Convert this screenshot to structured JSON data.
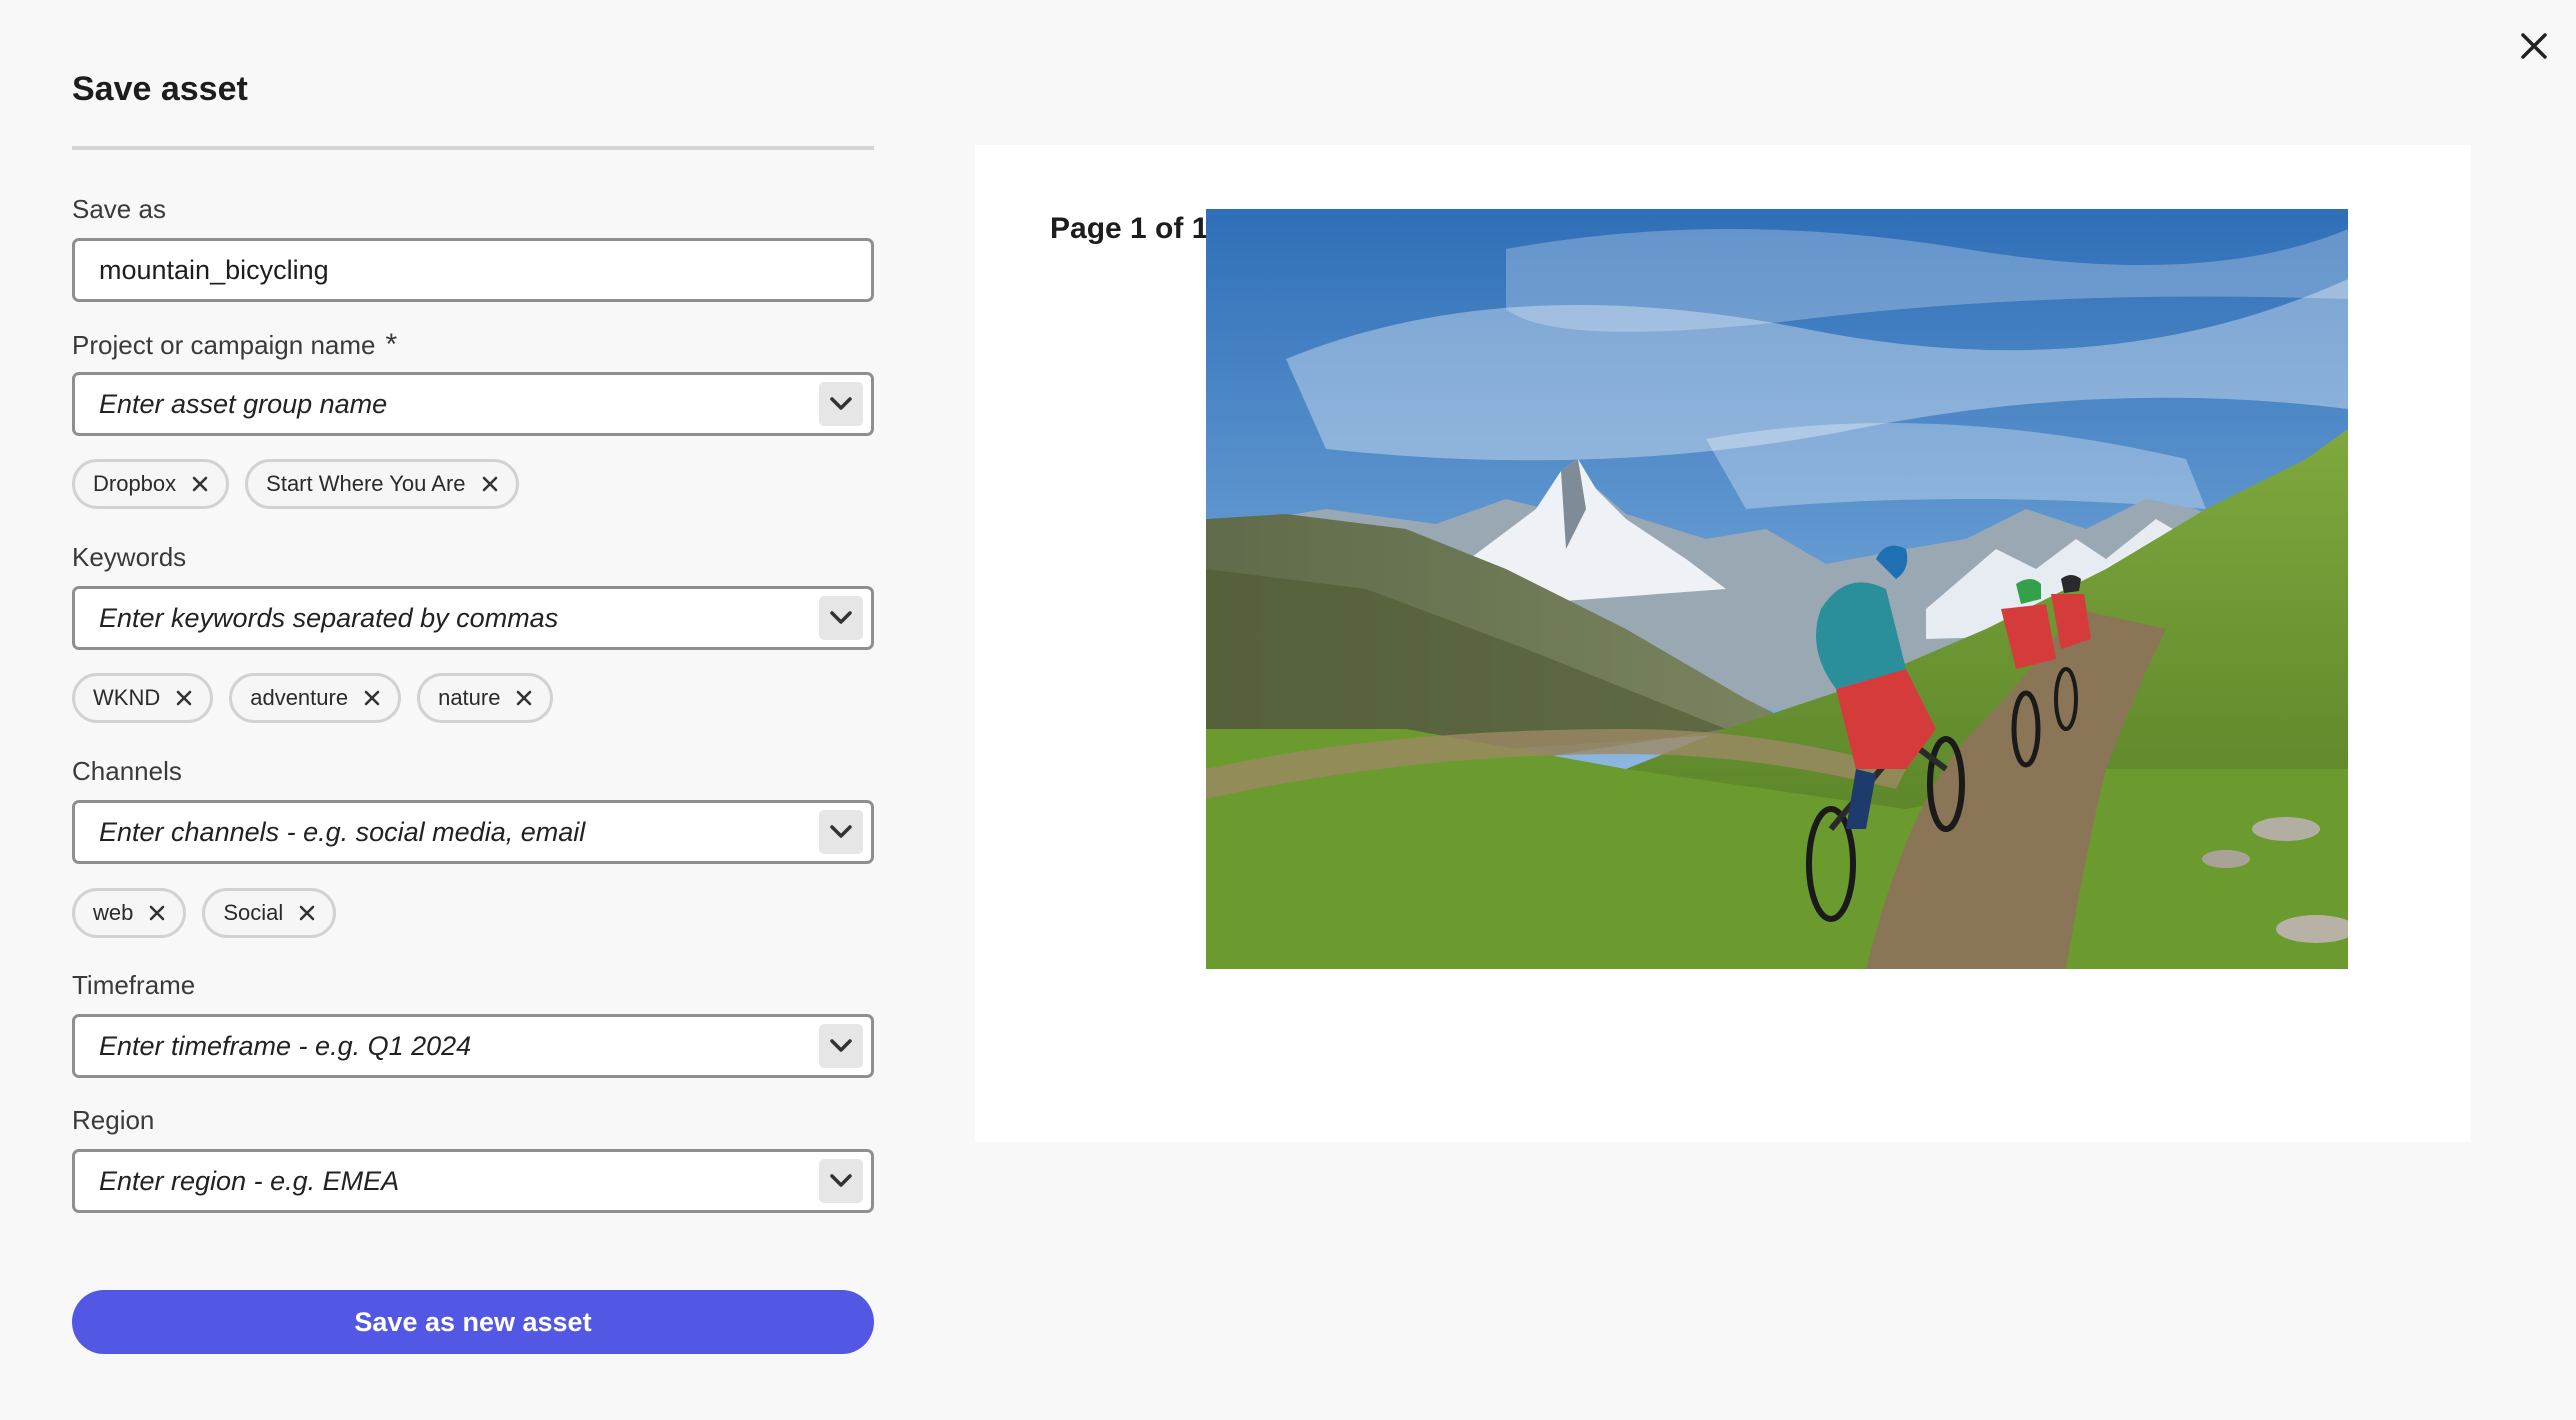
{
  "dialog": {
    "title": "Save asset"
  },
  "form": {
    "save_as": {
      "label": "Save as",
      "value": "mountain_bicycling"
    },
    "project": {
      "label": "Project or campaign name",
      "required_marker": "*",
      "placeholder": "Enter asset group name",
      "tags": [
        "Dropbox",
        "Start Where You Are"
      ]
    },
    "keywords": {
      "label": "Keywords",
      "placeholder": "Enter keywords separated by commas",
      "tags": [
        "WKND",
        "adventure",
        "nature"
      ]
    },
    "channels": {
      "label": "Channels",
      "placeholder": "Enter channels - e.g. social media, email",
      "tags": [
        "web",
        "Social"
      ]
    },
    "timeframe": {
      "label": "Timeframe",
      "placeholder": "Enter timeframe - e.g. Q1 2024"
    },
    "region": {
      "label": "Region",
      "placeholder": "Enter region - e.g. EMEA"
    },
    "submit_label": "Save as new asset"
  },
  "preview": {
    "page_label": "Page 1 of 1"
  },
  "icons": {
    "close": "close-icon",
    "chevron": "chevron-down-icon",
    "tag_remove": "x-icon"
  },
  "colors": {
    "accent": "#5258e4",
    "background": "#f8f8f8"
  }
}
